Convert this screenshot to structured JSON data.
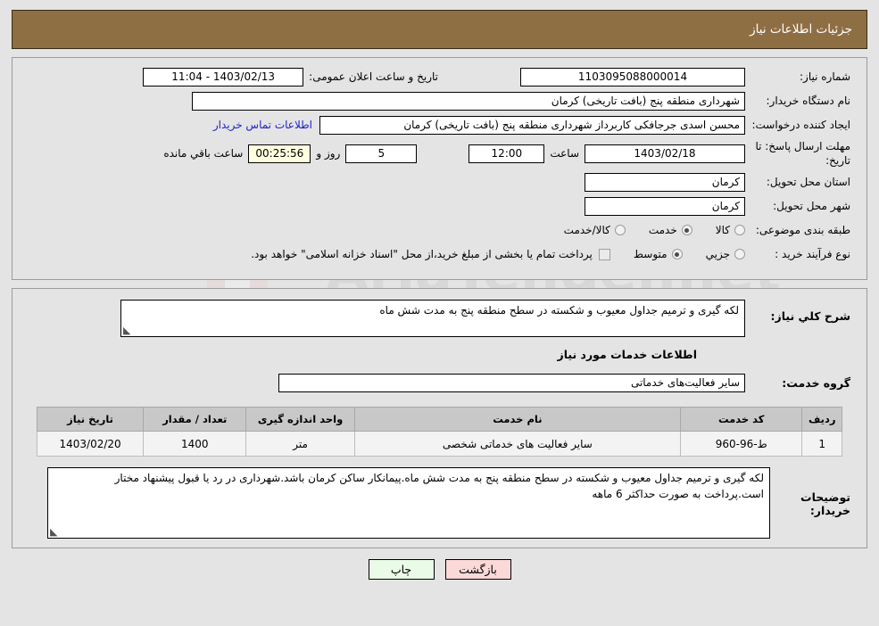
{
  "header": {
    "title": "جزئیات اطلاعات نیاز"
  },
  "colors": {
    "header_bg": "#8e6e43",
    "page_bg": "#e4e4e4",
    "table_header_bg": "#c8c8c8",
    "link": "#2020d0",
    "timer_bg": "#ffffe0",
    "print_button_bg": "#eafbe7",
    "back_button_bg": "#fbd9d9"
  },
  "form": {
    "need_number_label": "شماره نیاز:",
    "need_number_value": "1103095088000014",
    "public_announce_label": "تاریخ و ساعت اعلان عمومی:",
    "public_announce_value": "1403/02/13 - 11:04",
    "buyer_org_label": "نام دستگاه خریدار:",
    "buyer_org_value": "شهرداری منطقه پنج (بافت تاریخی) کرمان",
    "creator_label": "ایجاد کننده درخواست:",
    "creator_value": "محسن اسدی جرجافکی کاربرداز شهرداری منطقه پنج (بافت تاریخی) کرمان",
    "contact_link": "اطلاعات تماس خریدار",
    "deadline_label": "مهلت ارسال پاسخ: تا تاریخ:",
    "deadline_value": "1403/02/18",
    "hour_label": "ساعت",
    "hour_value": "12:00",
    "days_value": "5",
    "days_label": "روز و",
    "timer_value": "00:25:56",
    "timer_label": "ساعت باقي مانده",
    "province_label": "استان محل تحویل:",
    "province_value": "کرمان",
    "city_label": "شهر محل تحویل:",
    "city_value": "کرمان",
    "category_label": "طبقه بندی موضوعی:",
    "category_options": [
      {
        "label": "کالا",
        "selected": false
      },
      {
        "label": "خدمت",
        "selected": true
      },
      {
        "label": "کالا/خدمت",
        "selected": false
      }
    ],
    "process_label": "نوع فرآیند خرید :",
    "process_options": [
      {
        "label": "جزیي",
        "selected": false
      },
      {
        "label": "متوسط",
        "selected": true
      }
    ],
    "treasury_checkbox_checked": false,
    "treasury_note": "پرداخت تمام یا بخشی از مبلغ خرید،از محل \"اسناد خزانه اسلامی\" خواهد بود."
  },
  "details": {
    "need_desc_label": "شرح کلي نیاز:",
    "need_desc_value": "لکه گیری و ترمیم جداول معیوب و شکسته در سطح منطقه پنج به مدت شش ماه",
    "services_section_title": "اطلاعات خدمات مورد نیاز",
    "service_group_label": "گروه خدمت:",
    "service_group_value": "سایر فعالیت‌های خدماتی"
  },
  "items_table": {
    "columns": [
      "ردیف",
      "کد خدمت",
      "نام خدمت",
      "واحد اندازه گیری",
      "تعداد / مقدار",
      "تاریخ نیاز"
    ],
    "rows": [
      {
        "radif": "1",
        "code": "ط-96-960",
        "name": "سایر فعالیت های خدماتی شخصی",
        "unit": "متر",
        "qty": "1400",
        "date": "1403/02/20"
      }
    ]
  },
  "buyer_notes": {
    "label": "توضیحات خریدار:",
    "value": "لکه گیری و ترمیم جداول معیوب و شکسته در سطح منطقه پنج به مدت شش ماه.پیمانکار ساکن کرمان باشد.شهرداری در رد یا قبول پیشنهاد مختار است.پرداخت به صورت حداکثر 6 ماهه"
  },
  "footer": {
    "print_label": "چاپ",
    "back_label": "بازگشت"
  },
  "watermark": {
    "text": "AriaTender.net"
  }
}
